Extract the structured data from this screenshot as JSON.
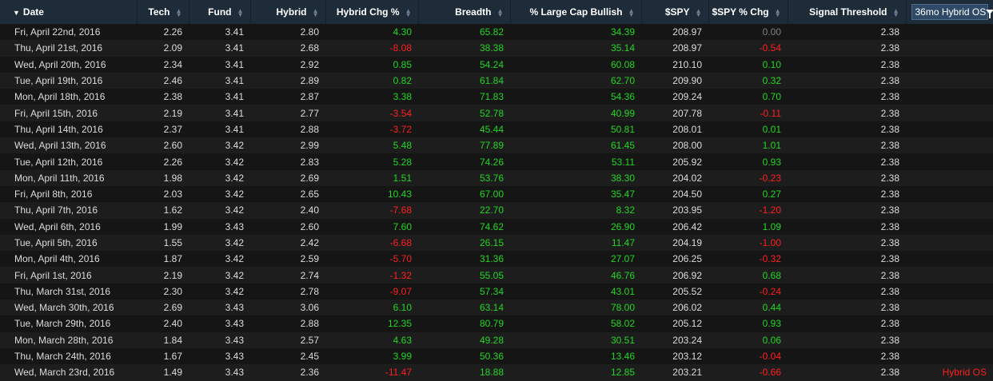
{
  "colors": {
    "positive": "#22d622",
    "negative": "#ff1f1f",
    "neutral": "#808080",
    "header_bg": "#1e2c3a"
  },
  "header": {
    "date": "Date",
    "tech": "Tech",
    "fund": "Fund",
    "hybrid": "Hybrid",
    "hybrid_chg": "Hybrid Chg %",
    "breadth": "Breadth",
    "large_cap": "% Large Cap Bullish",
    "spy": "$SPY",
    "spy_chg": "$SPY % Chg",
    "signal": "Signal Threshold",
    "os_filter": "36mo Hybrid OS"
  },
  "rows": [
    {
      "date": "Fri, April 22nd, 2016",
      "tech": "2.26",
      "fund": "3.41",
      "hybrid": "2.80",
      "hchg": "4.30",
      "breadth": "65.82",
      "lcb": "34.39",
      "spy": "208.97",
      "spychg": "0.00",
      "signal": "2.38",
      "os": ""
    },
    {
      "date": "Thu, April 21st, 2016",
      "tech": "2.09",
      "fund": "3.41",
      "hybrid": "2.68",
      "hchg": "-8.08",
      "breadth": "38.38",
      "lcb": "35.14",
      "spy": "208.97",
      "spychg": "-0.54",
      "signal": "2.38",
      "os": ""
    },
    {
      "date": "Wed, April 20th, 2016",
      "tech": "2.34",
      "fund": "3.41",
      "hybrid": "2.92",
      "hchg": "0.85",
      "breadth": "54.24",
      "lcb": "60.08",
      "spy": "210.10",
      "spychg": "0.10",
      "signal": "2.38",
      "os": ""
    },
    {
      "date": "Tue, April 19th, 2016",
      "tech": "2.46",
      "fund": "3.41",
      "hybrid": "2.89",
      "hchg": "0.82",
      "breadth": "61.84",
      "lcb": "62.70",
      "spy": "209.90",
      "spychg": "0.32",
      "signal": "2.38",
      "os": ""
    },
    {
      "date": "Mon, April 18th, 2016",
      "tech": "2.38",
      "fund": "3.41",
      "hybrid": "2.87",
      "hchg": "3.38",
      "breadth": "71.83",
      "lcb": "54.36",
      "spy": "209.24",
      "spychg": "0.70",
      "signal": "2.38",
      "os": ""
    },
    {
      "date": "Fri, April 15th, 2016",
      "tech": "2.19",
      "fund": "3.41",
      "hybrid": "2.77",
      "hchg": "-3.54",
      "breadth": "52.78",
      "lcb": "40.99",
      "spy": "207.78",
      "spychg": "-0.11",
      "signal": "2.38",
      "os": ""
    },
    {
      "date": "Thu, April 14th, 2016",
      "tech": "2.37",
      "fund": "3.41",
      "hybrid": "2.88",
      "hchg": "-3.72",
      "breadth": "45.44",
      "lcb": "50.81",
      "spy": "208.01",
      "spychg": "0.01",
      "signal": "2.38",
      "os": ""
    },
    {
      "date": "Wed, April 13th, 2016",
      "tech": "2.60",
      "fund": "3.42",
      "hybrid": "2.99",
      "hchg": "5.48",
      "breadth": "77.89",
      "lcb": "61.45",
      "spy": "208.00",
      "spychg": "1.01",
      "signal": "2.38",
      "os": ""
    },
    {
      "date": "Tue, April 12th, 2016",
      "tech": "2.26",
      "fund": "3.42",
      "hybrid": "2.83",
      "hchg": "5.28",
      "breadth": "74.26",
      "lcb": "53.11",
      "spy": "205.92",
      "spychg": "0.93",
      "signal": "2.38",
      "os": ""
    },
    {
      "date": "Mon, April 11th, 2016",
      "tech": "1.98",
      "fund": "3.42",
      "hybrid": "2.69",
      "hchg": "1.51",
      "breadth": "53.76",
      "lcb": "38.30",
      "spy": "204.02",
      "spychg": "-0.23",
      "signal": "2.38",
      "os": ""
    },
    {
      "date": "Fri, April 8th, 2016",
      "tech": "2.03",
      "fund": "3.42",
      "hybrid": "2.65",
      "hchg": "10.43",
      "breadth": "67.00",
      "lcb": "35.47",
      "spy": "204.50",
      "spychg": "0.27",
      "signal": "2.38",
      "os": ""
    },
    {
      "date": "Thu, April 7th, 2016",
      "tech": "1.62",
      "fund": "3.42",
      "hybrid": "2.40",
      "hchg": "-7.68",
      "breadth": "22.70",
      "lcb": "8.32",
      "spy": "203.95",
      "spychg": "-1.20",
      "signal": "2.38",
      "os": ""
    },
    {
      "date": "Wed, April 6th, 2016",
      "tech": "1.99",
      "fund": "3.43",
      "hybrid": "2.60",
      "hchg": "7.60",
      "breadth": "74.62",
      "lcb": "26.90",
      "spy": "206.42",
      "spychg": "1.09",
      "signal": "2.38",
      "os": ""
    },
    {
      "date": "Tue, April 5th, 2016",
      "tech": "1.55",
      "fund": "3.42",
      "hybrid": "2.42",
      "hchg": "-6.68",
      "breadth": "26.15",
      "lcb": "11.47",
      "spy": "204.19",
      "spychg": "-1.00",
      "signal": "2.38",
      "os": ""
    },
    {
      "date": "Mon, April 4th, 2016",
      "tech": "1.87",
      "fund": "3.42",
      "hybrid": "2.59",
      "hchg": "-5.70",
      "breadth": "31.36",
      "lcb": "27.07",
      "spy": "206.25",
      "spychg": "-0.32",
      "signal": "2.38",
      "os": ""
    },
    {
      "date": "Fri, April 1st, 2016",
      "tech": "2.19",
      "fund": "3.42",
      "hybrid": "2.74",
      "hchg": "-1.32",
      "breadth": "55.05",
      "lcb": "46.76",
      "spy": "206.92",
      "spychg": "0.68",
      "signal": "2.38",
      "os": ""
    },
    {
      "date": "Thu, March 31st, 2016",
      "tech": "2.30",
      "fund": "3.42",
      "hybrid": "2.78",
      "hchg": "-9.07",
      "breadth": "57.34",
      "lcb": "43.01",
      "spy": "205.52",
      "spychg": "-0.24",
      "signal": "2.38",
      "os": ""
    },
    {
      "date": "Wed, March 30th, 2016",
      "tech": "2.69",
      "fund": "3.43",
      "hybrid": "3.06",
      "hchg": "6.10",
      "breadth": "63.14",
      "lcb": "78.00",
      "spy": "206.02",
      "spychg": "0.44",
      "signal": "2.38",
      "os": ""
    },
    {
      "date": "Tue, March 29th, 2016",
      "tech": "2.40",
      "fund": "3.43",
      "hybrid": "2.88",
      "hchg": "12.35",
      "breadth": "80.79",
      "lcb": "58.02",
      "spy": "205.12",
      "spychg": "0.93",
      "signal": "2.38",
      "os": ""
    },
    {
      "date": "Mon, March 28th, 2016",
      "tech": "1.84",
      "fund": "3.43",
      "hybrid": "2.57",
      "hchg": "4.63",
      "breadth": "49.28",
      "lcb": "30.51",
      "spy": "203.24",
      "spychg": "0.06",
      "signal": "2.38",
      "os": ""
    },
    {
      "date": "Thu, March 24th, 2016",
      "tech": "1.67",
      "fund": "3.43",
      "hybrid": "2.45",
      "hchg": "3.99",
      "breadth": "50.36",
      "lcb": "13.46",
      "spy": "203.12",
      "spychg": "-0.04",
      "signal": "2.38",
      "os": ""
    },
    {
      "date": "Wed, March 23rd, 2016",
      "tech": "1.49",
      "fund": "3.43",
      "hybrid": "2.36",
      "hchg": "-11.47",
      "breadth": "18.88",
      "lcb": "12.85",
      "spy": "203.21",
      "spychg": "-0.66",
      "signal": "2.38",
      "os": "Hybrid OS"
    }
  ]
}
